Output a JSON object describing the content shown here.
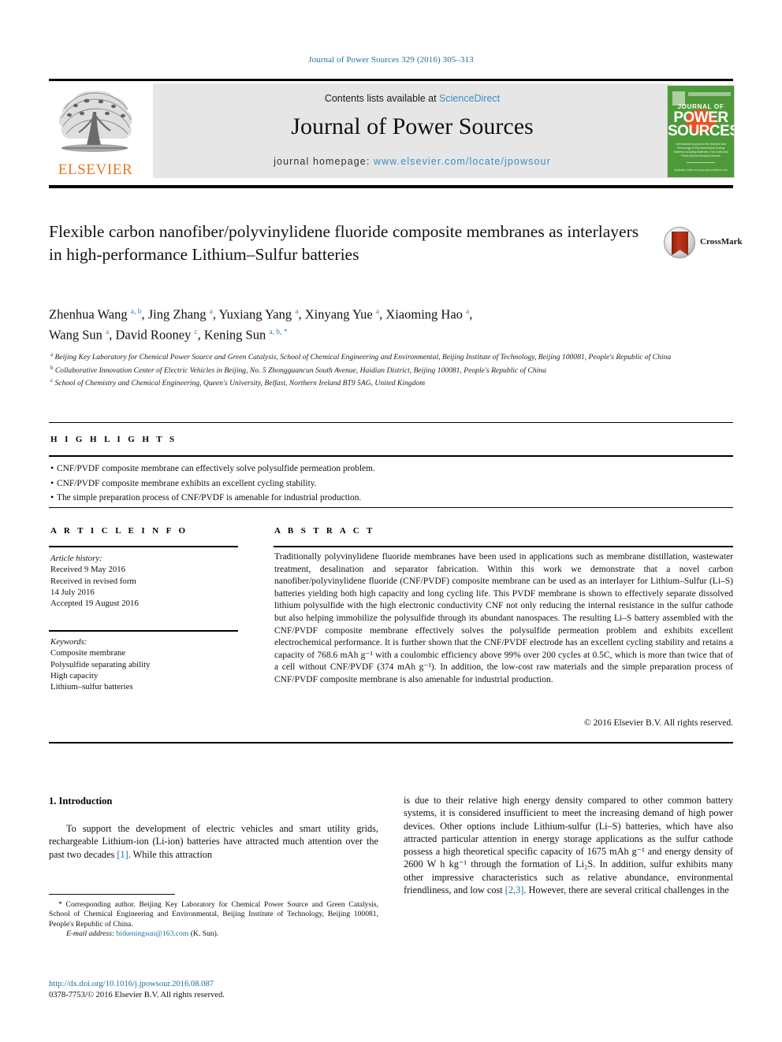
{
  "header": {
    "journal_ref": "Journal of Power Sources 329 (2016) 305–313",
    "contents_prefix": "Contents lists available at ",
    "contents_link": "ScienceDirect",
    "journal_name": "Journal of Power Sources",
    "homepage_prefix": "journal homepage: ",
    "homepage_url": "www.elsevier.com/locate/jpowsour",
    "publisher_logo_text": "ELSEVIER",
    "cover": {
      "journal_of": "JOURNAL OF",
      "power": "POWER",
      "sources": "SOURCES",
      "subtitle": "International journal on the Science and Technology of Electrochemical Energy Systems including Batteries, Fuel Cells and Photo-Electrochemical Devices",
      "footer": "Available online at www.sciencedirect.com"
    },
    "crossmark_label": "CrossMark"
  },
  "article": {
    "title": "Flexible carbon nanofiber/polyvinylidene fluoride composite membranes as interlayers in high-performance Lithium–Sulfur batteries",
    "authors_line1": "Zhenhua Wang a, b, Jing Zhang a, Yuxiang Yang a, Xinyang Yue a, Xiaoming Hao a,",
    "authors_line2": "Wang Sun a, David Rooney c, Kening Sun a, b, *",
    "affiliations": [
      "a Beijing Key Laboratory for Chemical Power Source and Green Catalysis, School of Chemical Engineering and Environmental, Beijing Institute of Technology, Beijing 100081, People's Republic of China",
      "b Collaborative Innovation Center of Electric Vehicles in Beijing, No. 5 Zhongguancun South Avenue, Haidian District, Beijing 100081, People's Republic of China",
      "c School of Chemistry and Chemical Engineering, Queen's University, Belfast, Northern Ireland BT9 5AG, United Kingdom"
    ]
  },
  "highlights": {
    "heading": "H I G H L I G H T S",
    "items": [
      "CNF/PVDF composite membrane can effectively solve polysulfide permeation problem.",
      "CNF/PVDF composite membrane exhibits an excellent cycling stability.",
      "The simple preparation process of CNF/PVDF is amenable for industrial production."
    ]
  },
  "article_info": {
    "heading": "A R T I C L E   I N F O",
    "history_label": "Article history:",
    "history_lines": [
      "Received 9 May 2016",
      "Received in revised form",
      "14 July 2016",
      "Accepted 19 August 2016"
    ],
    "keywords_label": "Keywords:",
    "keywords": [
      "Composite membrane",
      "Polysulfide separating ability",
      "High capacity",
      "Lithium–sulfur batteries"
    ]
  },
  "abstract": {
    "heading": "A B S T R A C T",
    "text": "Traditionally polyvinylidene fluoride membranes have been used in applications such as membrane distillation, wastewater treatment, desalination and separator fabrication. Within this work we demonstrate that a novel carbon nanofiber/polyvinylidene fluoride (CNF/PVDF) composite membrane can be used as an interlayer for Lithium–Sulfur (Li–S) batteries yielding both high capacity and long cycling life. This PVDF membrane is shown to effectively separate dissolved lithium polysulfide with the high electronic conductivity CNF not only reducing the internal resistance in the sulfur cathode but also helping immobilize the polysulfide through its abundant nanospaces. The resulting Li–S battery assembled with the CNF/PVDF composite membrane effectively solves the polysulfide permeation problem and exhibits excellent electrochemical performance. It is further shown that the CNF/PVDF electrode has an excellent cycling stability and retains a capacity of 768.6 mAh g⁻¹ with a coulombic efficiency above 99% over 200 cycles at 0.5C, which is more than twice that of a cell without CNF/PVDF (374 mAh g⁻¹). In addition, the low-cost raw materials and the simple preparation process of CNF/PVDF composite membrane is also amenable for industrial production.",
    "copyright": "© 2016 Elsevier B.V. All rights reserved."
  },
  "body": {
    "section_number_title": "1.  Introduction",
    "left_paragraph_pre": "To support the development of electric vehicles and smart utility grids, rechargeable Lithium-ion (Li-ion) batteries have attracted much attention over the past two decades ",
    "left_ref": "[1]",
    "left_paragraph_post": ". While this attraction",
    "right_paragraph_pre": "is due to their relative high energy density compared to other common battery systems, it is considered insufficient to meet the increasing demand of high power devices. Other options include Lithium-sulfur (Li–S) batteries, which have also attracted particular attention in energy storage applications as the sulfur cathode possess a high theoretical specific capacity of 1675 mAh g⁻¹ and energy density of 2600 W h kg⁻¹ through the formation of Li₂S. In addition, sulfur exhibits many other impressive characteristics such as relative abundance, environmental friendliness, and low cost ",
    "right_ref": "[2,3]",
    "right_paragraph_post": ". However, there are several critical challenges in the"
  },
  "footer": {
    "corresponding_marker": "*",
    "corresponding_text": " Corresponding author. Beijing Key Laboratory for Chemical Power Source and Green Catalysis, School of Chemical Engineering and Environmental, Beijing Institute of Technology, Beijing 100081, People's Republic of China.",
    "email_label": "E-mail address:",
    "email": "bitkeningsun@163.com",
    "email_owner": "(K. Sun).",
    "doi": "http://dx.doi.org/10.1016/j.jpowsour.2016.08.087",
    "issn_copyright": "0378-7753/© 2016 Elsevier B.V. All rights reserved."
  },
  "colors": {
    "link_blue": "#1f6f9c",
    "sciencedirect_blue": "#3a8ec4",
    "elsevier_orange": "#E87722",
    "cover_green": "#4e9a3a",
    "masthead_gray": "#e6e6e6"
  }
}
